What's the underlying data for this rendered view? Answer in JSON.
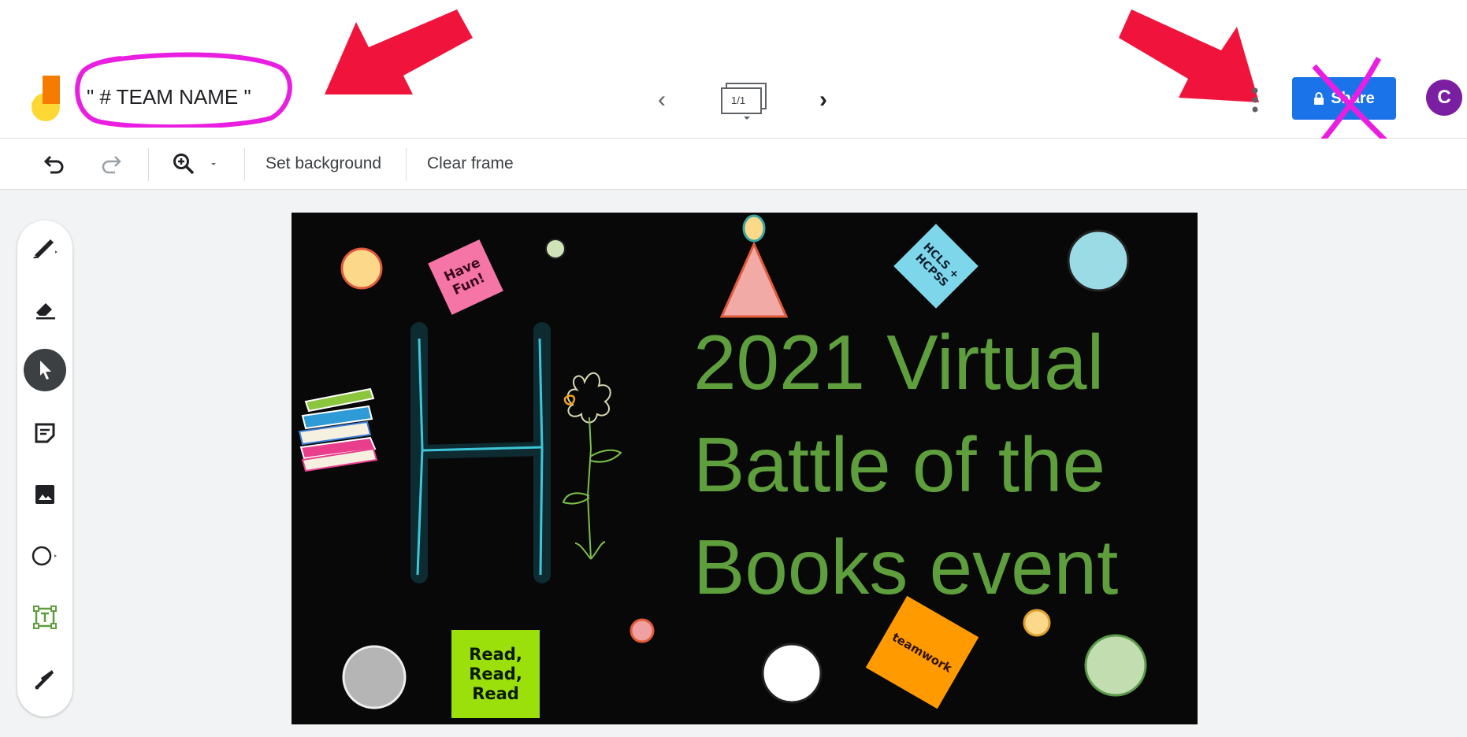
{
  "header": {
    "title": "\" # TEAM NAME \"",
    "frame_counter": "1/1",
    "share_label": "Share",
    "avatar_initial": "C"
  },
  "toolbar": {
    "set_background": "Set background",
    "clear_frame": "Clear frame"
  },
  "tools": [
    "pen-icon",
    "eraser-icon",
    "select-icon",
    "sticky-note-icon",
    "image-icon",
    "circle-shape-icon",
    "text-box-icon",
    "laser-icon"
  ],
  "board": {
    "headline_line1": "2021 Virtual",
    "headline_line2": "Battle of the",
    "headline_line3": "Books event",
    "sticky_have_fun": "Have Fun!",
    "sticky_hcls": "HCLS + HCPSS",
    "sticky_read": "Read, Read, Read",
    "sticky_teamwork": "teamwork"
  },
  "colors": {
    "share_blue": "#1a73e8",
    "avatar_purple": "#7b1fa2",
    "annotation_magenta": "#e91ee0",
    "annotation_red": "#f0143c",
    "headline_green": "#5e9e3c"
  }
}
